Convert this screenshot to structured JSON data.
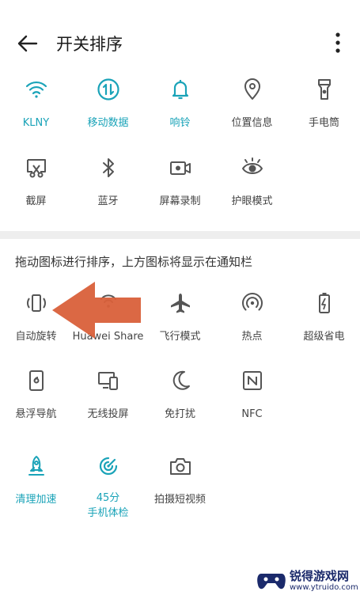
{
  "header": {
    "title": "开关排序"
  },
  "top_tiles": [
    {
      "label": "KLNY",
      "icon": "wifi-icon",
      "active": true
    },
    {
      "label": "移动数据",
      "icon": "mobile-data-icon",
      "active": true
    },
    {
      "label": "响铃",
      "icon": "bell-icon",
      "active": true
    },
    {
      "label": "位置信息",
      "icon": "location-icon",
      "active": false
    },
    {
      "label": "手电筒",
      "icon": "flashlight-icon",
      "active": false
    },
    {
      "label": "截屏",
      "icon": "screenshot-icon",
      "active": false
    },
    {
      "label": "蓝牙",
      "icon": "bluetooth-icon",
      "active": false
    },
    {
      "label": "屏幕录制",
      "icon": "screen-record-icon",
      "active": false
    },
    {
      "label": "护眼模式",
      "icon": "eye-comfort-icon",
      "active": false
    }
  ],
  "hint": "拖动图标进行排序，上方图标将显示在通知栏",
  "bottom_tiles": [
    {
      "label": "自动旋转",
      "icon": "auto-rotate-icon",
      "active": false
    },
    {
      "label": "Huawei Share",
      "icon": "share-icon",
      "active": false
    },
    {
      "label": "飞行模式",
      "icon": "airplane-icon",
      "active": false
    },
    {
      "label": "热点",
      "icon": "hotspot-icon",
      "active": false
    },
    {
      "label": "超级省电",
      "icon": "battery-saver-icon",
      "active": false
    },
    {
      "label": "悬浮导航",
      "icon": "floating-nav-icon",
      "active": false
    },
    {
      "label": "无线投屏",
      "icon": "wireless-projection-icon",
      "active": false
    },
    {
      "label": "免打扰",
      "icon": "moon-icon",
      "active": false
    },
    {
      "label": "NFC",
      "icon": "nfc-icon",
      "active": false
    },
    {
      "label": "清理加速",
      "icon": "rocket-icon",
      "active": true
    },
    {
      "label": "45分",
      "label2": "手机体检",
      "icon": "phone-checkup-icon",
      "active": true
    },
    {
      "label": "拍摄短视频",
      "icon": "camera-icon",
      "active": false
    }
  ],
  "watermark": {
    "name": "锐得游戏网",
    "url": "www.ytruido.com"
  },
  "colors": {
    "accent": "#1aa3b8",
    "arrow": "#d9603a",
    "divider": "#eeeeee"
  }
}
